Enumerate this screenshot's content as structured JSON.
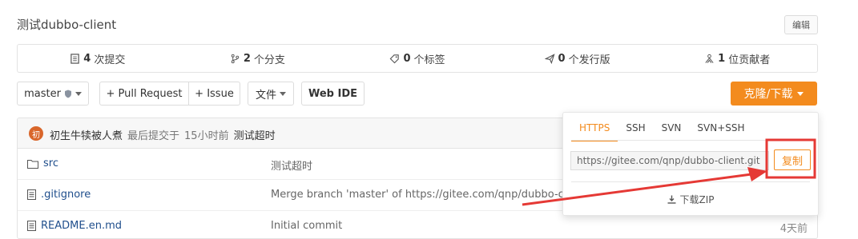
{
  "repo": {
    "description": "测试dubbo-client",
    "edit_label": "编辑"
  },
  "stats": [
    {
      "icon": "commit-icon",
      "count": "4",
      "label": "次提交"
    },
    {
      "icon": "branch-icon",
      "count": "2",
      "label": "个分支"
    },
    {
      "icon": "tag-icon",
      "count": "0",
      "label": "个标签"
    },
    {
      "icon": "release-icon",
      "count": "0",
      "label": "个发行版"
    },
    {
      "icon": "contributors-icon",
      "count": "1",
      "label": "位贡献者"
    }
  ],
  "toolbar": {
    "branch": "master",
    "pull_request": "+ Pull Request",
    "issue": "+ Issue",
    "file": "文件",
    "web_ide": "Web IDE",
    "clone": "克隆/下载"
  },
  "commit": {
    "avatar_char": "初",
    "author": "初生牛犊被人煮",
    "label": "最后提交于",
    "time": "15小时前",
    "message": "测试超时"
  },
  "files": [
    {
      "name": "src",
      "type": "folder",
      "message": "测试超时",
      "time": ""
    },
    {
      "name": ".gitignore",
      "type": "file",
      "message": "Merge branch 'master' of https://gitee.com/qnp/dubbo-cli",
      "time": ""
    },
    {
      "name": "README.en.md",
      "type": "file",
      "message": "Initial commit",
      "time": "4天前"
    }
  ],
  "clone_menu": {
    "tabs": [
      "HTTPS",
      "SSH",
      "SVN",
      "SVN+SSH"
    ],
    "url": "https://gitee.com/qnp/dubbo-client.git",
    "copy_label": "复制",
    "zip_label": "下载ZIP"
  },
  "colors": {
    "accent": "#f38b1e",
    "annotation": "#e53935"
  }
}
